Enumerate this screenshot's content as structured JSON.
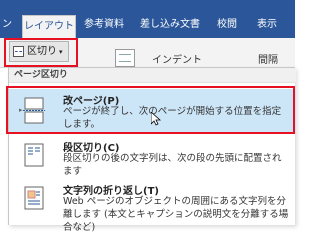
{
  "ribbon": {
    "tabs": [
      {
        "label": "ン",
        "active": false
      },
      {
        "label": "レイアウト",
        "active": true
      },
      {
        "label": "参考資料",
        "active": false
      },
      {
        "label": "差し込み文書",
        "active": false
      },
      {
        "label": "校閲",
        "active": false
      },
      {
        "label": "表示",
        "active": false
      }
    ],
    "breaks_button": {
      "label": "区切り",
      "caret": "▾"
    },
    "indent_label": "インデント",
    "spacing_label": "間隔"
  },
  "menu": {
    "section_header": "ページ区切り",
    "items": [
      {
        "title": "改ページ(P)",
        "description": "ページが終了し、次のページが開始する位置を指定します。",
        "highlighted": true,
        "icon": "page-break-icon"
      },
      {
        "title": "段区切り(C)",
        "description": "段区切りの後の文字列は、次の段の先頭に配置されます",
        "highlighted": false,
        "icon": "column-break-icon"
      },
      {
        "title": "文字列の折り返し(T)",
        "description": "Web ページのオブジェクトの周囲にある文字列を分離します (本文とキャプションの説明文を分離する場合など)",
        "highlighted": false,
        "icon": "text-wrapping-icon"
      }
    ]
  },
  "colors": {
    "ribbon_blue": "#2b579a",
    "highlight": "#cde6f7",
    "outline_red": "#e81123"
  }
}
